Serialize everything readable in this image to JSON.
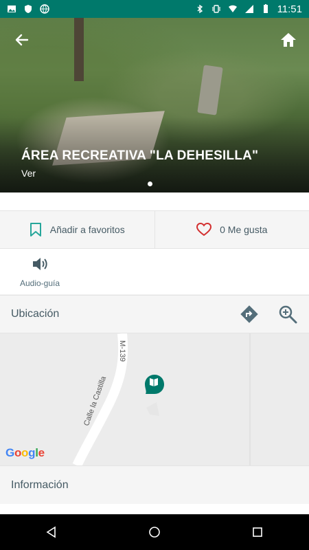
{
  "status_bar": {
    "time": "11:51",
    "left_icons": [
      "image-icon",
      "shield-icon",
      "globe-icon"
    ],
    "right_icons": [
      "bluetooth-icon",
      "vibrate-icon",
      "wifi-icon",
      "signal-icon",
      "battery-icon"
    ]
  },
  "hero": {
    "title": "ÁREA RECREATIVA \"LA DEHESILLA\"",
    "subtitle": "Ver"
  },
  "actions": {
    "favorites_label": "Añadir a favoritos",
    "like_label": "0 Me gusta"
  },
  "audio": {
    "label": "Audio-guía"
  },
  "location": {
    "title": "Ubicación"
  },
  "map": {
    "road_label_1": "M-139",
    "road_label_2": "Calle la Castilla",
    "attribution": "Google"
  },
  "info": {
    "title": "Información"
  },
  "colors": {
    "accent_teal": "#00796b",
    "heart_red": "#d32f2f",
    "text_gray": "#455a64"
  }
}
